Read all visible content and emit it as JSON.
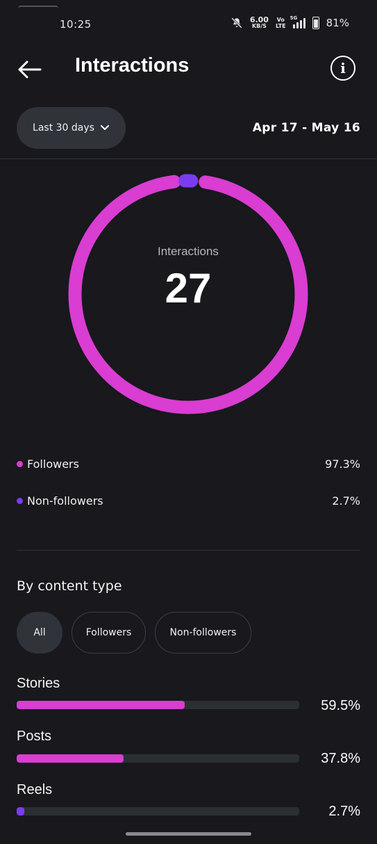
{
  "status_bar": {
    "time": "10:25",
    "speed_value": "6.00",
    "speed_unit": "KB/S",
    "volte_top": "Vo",
    "volte_bottom": "LTE",
    "network": "5G",
    "battery": "81%"
  },
  "header": {
    "title": "Interactions",
    "back_icon": "arrow-left-icon",
    "info_icon": "info-icon",
    "info_glyph": "i"
  },
  "range": {
    "label": "Last 30 days",
    "date_range": "Apr 17 - May 16"
  },
  "donut": {
    "label": "Interactions",
    "value": "27",
    "followers_fraction": 0.973,
    "non_followers_fraction": 0.027,
    "colors": {
      "followers": "#d93dd1",
      "non_followers": "#7b3cf0"
    }
  },
  "legend": [
    {
      "label": "Followers",
      "pct": "97.3%",
      "color": "#d93dd1"
    },
    {
      "label": "Non-followers",
      "pct": "2.7%",
      "color": "#7b3cf0"
    }
  ],
  "content_type": {
    "title": "By content type",
    "filters": [
      {
        "label": "All",
        "active": true
      },
      {
        "label": "Followers",
        "active": false
      },
      {
        "label": "Non-followers",
        "active": false
      }
    ],
    "metrics": [
      {
        "label": "Stories",
        "pct": "59.5%",
        "fraction": 0.595,
        "color": "#d93dd1"
      },
      {
        "label": "Posts",
        "pct": "37.8%",
        "fraction": 0.378,
        "color": "#d93dd1"
      },
      {
        "label": "Reels",
        "pct": "2.7%",
        "fraction": 0.027,
        "color": "#7b3cf0"
      }
    ]
  }
}
